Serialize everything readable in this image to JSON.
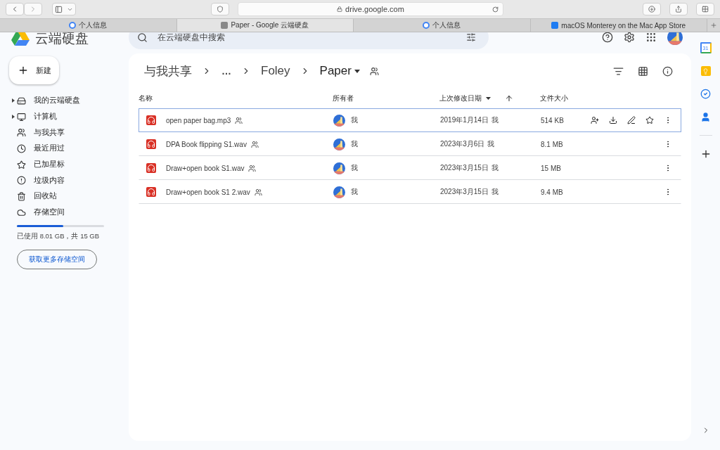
{
  "browser": {
    "url": "drive.google.com",
    "tabs": [
      {
        "title": "个人信息",
        "selected": false,
        "kind": "google"
      },
      {
        "title": "Paper - Google 云端硬盘",
        "selected": true,
        "kind": "drive"
      },
      {
        "title": "个人信息",
        "selected": false,
        "kind": "google"
      },
      {
        "title": "macOS Monterey on the Mac App Store",
        "selected": false,
        "kind": "appstore"
      }
    ]
  },
  "app": {
    "title": "云端硬盘",
    "search": {
      "placeholder": "在云端硬盘中搜索"
    }
  },
  "new_button": "新建",
  "sidebar": {
    "items": [
      {
        "label": "我的云端硬盘",
        "kind": "drive",
        "expandable": true,
        "selected": false
      },
      {
        "label": "计算机",
        "kind": "computer",
        "expandable": true,
        "selected": false
      },
      {
        "label": "与我共享",
        "kind": "shared",
        "expandable": false,
        "selected": false
      },
      {
        "label": "最近用过",
        "kind": "recent",
        "expandable": false,
        "selected": false
      },
      {
        "label": "已加星标",
        "kind": "star",
        "expandable": false,
        "selected": false
      },
      {
        "label": "垃圾内容",
        "kind": "spam",
        "expandable": false,
        "selected": false
      },
      {
        "label": "回收站",
        "kind": "trash",
        "expandable": false,
        "selected": false
      },
      {
        "label": "存储空间",
        "kind": "cloud",
        "expandable": false,
        "selected": false
      }
    ],
    "storage": {
      "level": 0.53,
      "text": "已使用 8.01 GB，共 15 GB",
      "button": "获取更多存储空间"
    }
  },
  "breadcrumb": [
    {
      "label": "与我共享",
      "kind": "link"
    },
    {
      "label": "…",
      "kind": "more"
    },
    {
      "label": "Foley",
      "kind": "link"
    },
    {
      "label": "Paper",
      "kind": "current"
    }
  ],
  "table": {
    "columns": [
      "名称",
      "所有者",
      "上次修改日期",
      "文件大小"
    ],
    "rows": [
      {
        "name": "open paper bag.mp3",
        "shared": true,
        "owner": "我",
        "modified": "2019年1月14日",
        "modifier": "我",
        "size": "514 KB",
        "selected": true
      },
      {
        "name": "DPA Book flipping S1.wav",
        "shared": true,
        "owner": "我",
        "modified": "2023年3月6日",
        "modifier": "我",
        "size": "8.1 MB",
        "selected": false
      },
      {
        "name": "Draw+open book S1.wav",
        "shared": true,
        "owner": "我",
        "modified": "2023年3月15日",
        "modifier": "我",
        "size": "15 MB",
        "selected": false
      },
      {
        "name": "Draw+open book S1 2.wav",
        "shared": true,
        "owner": "我",
        "modified": "2023年3月15日",
        "modifier": "我",
        "size": "9.4 MB",
        "selected": false
      }
    ]
  },
  "side_apps": [
    {
      "kind": "calendar",
      "label": "31"
    },
    {
      "kind": "keep"
    },
    {
      "kind": "tasks"
    },
    {
      "kind": "contacts"
    }
  ]
}
